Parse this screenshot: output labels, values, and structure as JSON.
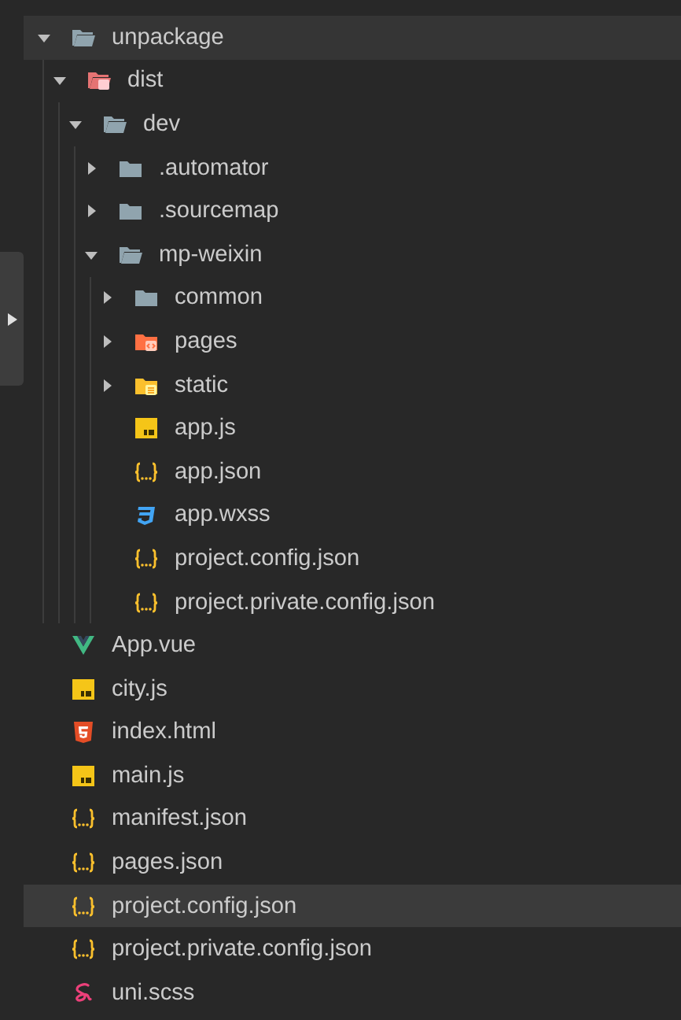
{
  "explorer": {
    "items": [
      {
        "name": "unpackage",
        "kind": "folder",
        "expanded": true,
        "selected": true,
        "children": [
          {
            "name": "dist",
            "kind": "folder-dist",
            "expanded": true,
            "selected": false,
            "children": [
              {
                "name": "dev",
                "kind": "folder",
                "expanded": true,
                "selected": false,
                "children": [
                  {
                    "name": ".automator",
                    "kind": "folder",
                    "expanded": false,
                    "selected": false
                  },
                  {
                    "name": ".sourcemap",
                    "kind": "folder",
                    "expanded": false,
                    "selected": false
                  },
                  {
                    "name": "mp-weixin",
                    "kind": "folder",
                    "expanded": true,
                    "selected": false,
                    "children": [
                      {
                        "name": "common",
                        "kind": "folder",
                        "expanded": false,
                        "selected": false
                      },
                      {
                        "name": "pages",
                        "kind": "folder-pages",
                        "expanded": false,
                        "selected": false
                      },
                      {
                        "name": "static",
                        "kind": "folder-static",
                        "expanded": false,
                        "selected": false
                      },
                      {
                        "name": "app.js",
                        "kind": "js",
                        "selected": false
                      },
                      {
                        "name": "app.json",
                        "kind": "json",
                        "selected": false
                      },
                      {
                        "name": "app.wxss",
                        "kind": "css",
                        "selected": false
                      },
                      {
                        "name": "project.config.json",
                        "kind": "json",
                        "selected": false
                      },
                      {
                        "name": "project.private.config.json",
                        "kind": "json",
                        "selected": false
                      }
                    ]
                  }
                ]
              }
            ]
          }
        ]
      },
      {
        "name": "App.vue",
        "kind": "vue",
        "selected": false
      },
      {
        "name": "city.js",
        "kind": "js",
        "selected": false
      },
      {
        "name": "index.html",
        "kind": "html",
        "selected": false
      },
      {
        "name": "main.js",
        "kind": "js",
        "selected": false
      },
      {
        "name": "manifest.json",
        "kind": "json",
        "selected": false
      },
      {
        "name": "pages.json",
        "kind": "json",
        "selected": false
      },
      {
        "name": "project.config.json",
        "kind": "json",
        "selected": true
      },
      {
        "name": "project.private.config.json",
        "kind": "json",
        "selected": false
      },
      {
        "name": "uni.scss",
        "kind": "scss",
        "selected": false
      }
    ]
  }
}
